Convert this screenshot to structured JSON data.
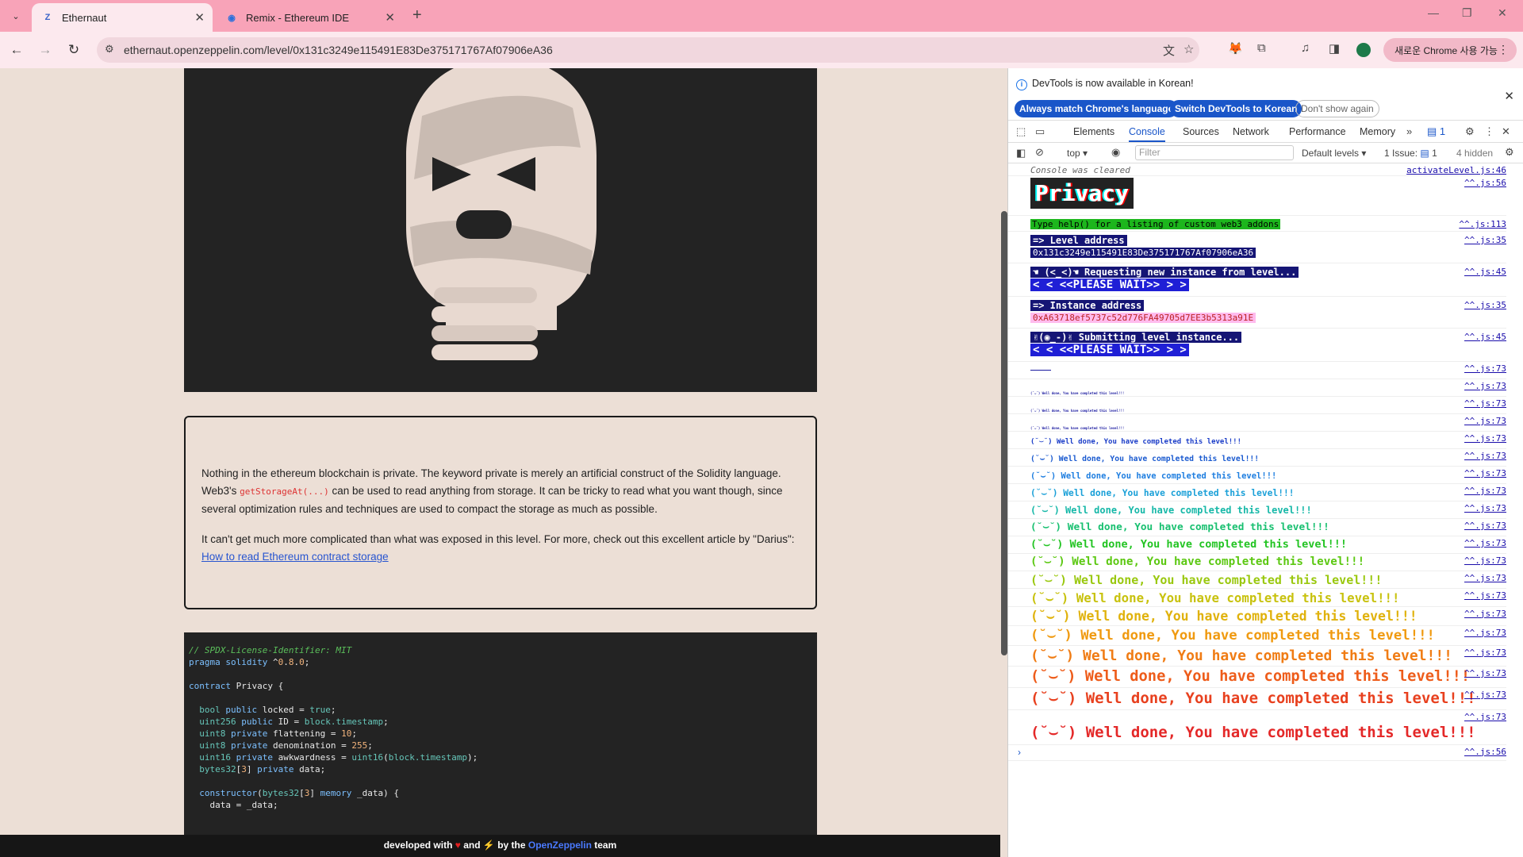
{
  "browser": {
    "tabs": [
      {
        "title": "Ethernaut",
        "active": true,
        "favicon": "ethernaut-logo"
      },
      {
        "title": "Remix - Ethereum IDE",
        "active": false,
        "favicon": "remix-logo"
      }
    ],
    "url": "ethernaut.openzeppelin.com/level/0x131c3249e115491E83De375171767Af07906eA36",
    "profile_pill": "새로운 Chrome 사용 가능",
    "accent_color": "#f8a3b8"
  },
  "page": {
    "info_paragraph_1_a": "Nothing in the ethereum blockchain is private. The keyword private is merely an artificial construct of the Solidity language. Web3's ",
    "info_code": "getStorageAt(...)",
    "info_paragraph_1_b": " can be used to read anything from storage. It can be tricky to read what you want though, since several optimization rules and techniques are used to compact the storage as much as possible.",
    "info_paragraph_2": "It can't get much more complicated than what was exposed in this level. For more, check out this excellent article by \"Darius\": ",
    "info_link": "How to read Ethereum contract storage",
    "code_lines": [
      "// SPDX-License-Identifier: MIT",
      "pragma solidity ^0.8.0;",
      "",
      "contract Privacy {",
      "",
      "  bool public locked = true;",
      "  uint256 public ID = block.timestamp;",
      "  uint8 private flattening = 10;",
      "  uint8 private denomination = 255;",
      "  uint16 private awkwardness = uint16(block.timestamp);",
      "  bytes32[3] private data;",
      "",
      "  constructor(bytes32[3] memory _data) {",
      "    data = _data;"
    ],
    "footer_a": "developed with",
    "footer_b": "and",
    "footer_c": "by the",
    "footer_link": "OpenZeppelin",
    "footer_d": "team"
  },
  "devtools": {
    "banner_msg": "DevTools is now available in Korean!",
    "btn_match": "Always match Chrome's language",
    "btn_switch": "Switch DevTools to Korean",
    "btn_dont": "Don't show again",
    "tabs": [
      "Elements",
      "Console",
      "Sources",
      "Network",
      "Performance",
      "Memory"
    ],
    "active_tab": "Console",
    "issues_badge": "1",
    "context": "top",
    "filter_placeholder": "Filter",
    "levels": "Default levels",
    "issues_text": "1 Issue:",
    "issues_count": "1",
    "hidden": "4 hidden",
    "console": {
      "cleared": "Console was cleared",
      "cleared_src": "activateLevel.js:46",
      "privacy_banner": "Privacy",
      "help_line": "Type help() for a listing of custom web3 addons",
      "level_addr_label": "=> Level address",
      "level_addr": "0x131c3249e115491E83De375171767Af07906eA36",
      "requesting": "☚ (<_<)☚ Requesting new instance from level...",
      "please_wait": "<  < <<PLEASE WAIT>> >  >",
      "instance_label": "=> Instance address",
      "instance_addr": "0xA63718ef5737c52d776FA49705d7EE3b5313a91E",
      "submitting": "✌(◉_-)✌ Submitting level instance...",
      "well_done": "(˘⌣˘) Well done, You have completed this level!!!",
      "src_56": "^^.js:56",
      "src_113": "^^.js:113",
      "src_35": "^^.js:35",
      "src_45": "^^.js:45",
      "src_73": "^^.js:73",
      "welldone_colors": [
        "#1a1aa0",
        "#1a1aa0",
        "#1a1aa0",
        "#1a1aa0",
        "#1a3cc8",
        "#1a5ad0",
        "#1e7ee0",
        "#1aa0d8",
        "#16b8a8",
        "#18c070",
        "#22c422",
        "#5cc812",
        "#9ac80e",
        "#c8c20e",
        "#e0b20c",
        "#f09a10",
        "#f07c14",
        "#ee5c1a",
        "#e8401e",
        "#e42828"
      ]
    }
  }
}
